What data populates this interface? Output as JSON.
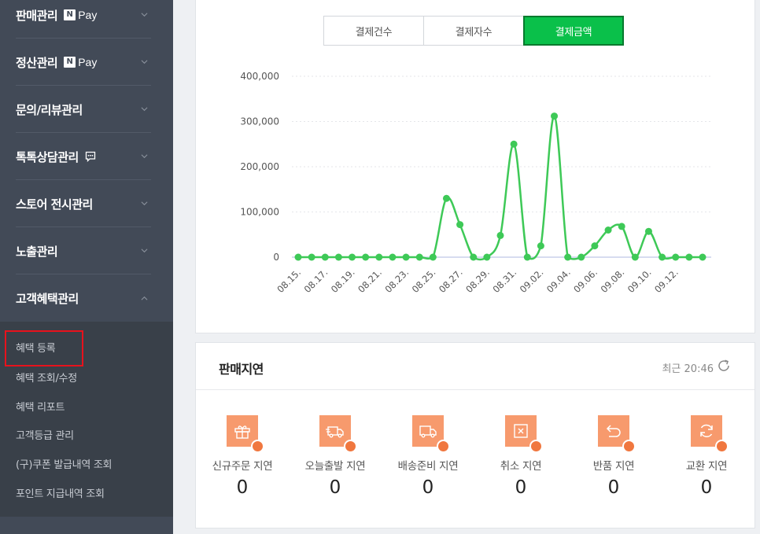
{
  "sidebar": {
    "menu": [
      {
        "label": "판매관리",
        "npay": true
      },
      {
        "label": "정산관리",
        "npay": true
      },
      {
        "label": "문의/리뷰관리"
      },
      {
        "label": "톡톡상담관리",
        "talk": true
      },
      {
        "label": "스토어 전시관리"
      },
      {
        "label": "노출관리"
      },
      {
        "label": "고객혜택관리",
        "expanded": true
      }
    ],
    "npay_box": "N",
    "npay_text": "Pay",
    "submenu": [
      "혜택 등록",
      "혜택 조회/수정",
      "혜택 리포트",
      "고객등급 관리",
      "(구)쿠폰 발급내역 조회",
      "포인트 지급내역 조회"
    ],
    "highlighted_item": "혜택 등록"
  },
  "chart_tabs": [
    "결제건수",
    "결제자수",
    "결제금액"
  ],
  "active_tab": "결제금액",
  "chart_data": {
    "type": "line",
    "x": [
      "08.15.",
      "08.16.",
      "08.17.",
      "08.18.",
      "08.19.",
      "08.20.",
      "08.21.",
      "08.22.",
      "08.23.",
      "08.24.",
      "08.25.",
      "08.26.",
      "08.27.",
      "08.28.",
      "08.29.",
      "08.30.",
      "08.31.",
      "09.01.",
      "09.02.",
      "09.03.",
      "09.04.",
      "09.05.",
      "09.06.",
      "09.07.",
      "09.08.",
      "09.09.",
      "09.10.",
      "09.11.",
      "09.12.",
      "09.13.",
      "09.14."
    ],
    "tick_labels": [
      "08.15.",
      "08.17.",
      "08.19.",
      "08.21.",
      "08.23.",
      "08.25.",
      "08.27.",
      "08.29.",
      "08.31.",
      "09.02.",
      "09.04.",
      "09.06.",
      "09.08.",
      "09.10.",
      "09.12."
    ],
    "values": [
      0,
      0,
      0,
      0,
      0,
      0,
      0,
      0,
      0,
      0,
      0,
      130000,
      72000,
      0,
      0,
      48000,
      250000,
      0,
      25000,
      312000,
      0,
      0,
      25000,
      60000,
      68000,
      0,
      57000,
      0,
      0,
      0,
      0
    ],
    "yticks": [
      "0",
      "100,000",
      "200,000",
      "300,000",
      "400,000"
    ],
    "ylim": [
      0,
      400000
    ],
    "color": "#3ec957",
    "grid": true
  },
  "delay": {
    "title": "판매지연",
    "time_label": "최근 20:46",
    "items": [
      {
        "label": "신규주문 지연",
        "value": "0",
        "icon": "gift-icon"
      },
      {
        "label": "오늘출발 지연",
        "value": "0",
        "icon": "fast-truck-icon"
      },
      {
        "label": "배송준비 지연",
        "value": "0",
        "icon": "truck-icon"
      },
      {
        "label": "취소 지연",
        "value": "0",
        "icon": "cancel-icon"
      },
      {
        "label": "반품 지연",
        "value": "0",
        "icon": "return-icon"
      },
      {
        "label": "교환 지연",
        "value": "0",
        "icon": "exchange-icon"
      }
    ],
    "icon_color": "#f79a6d"
  }
}
